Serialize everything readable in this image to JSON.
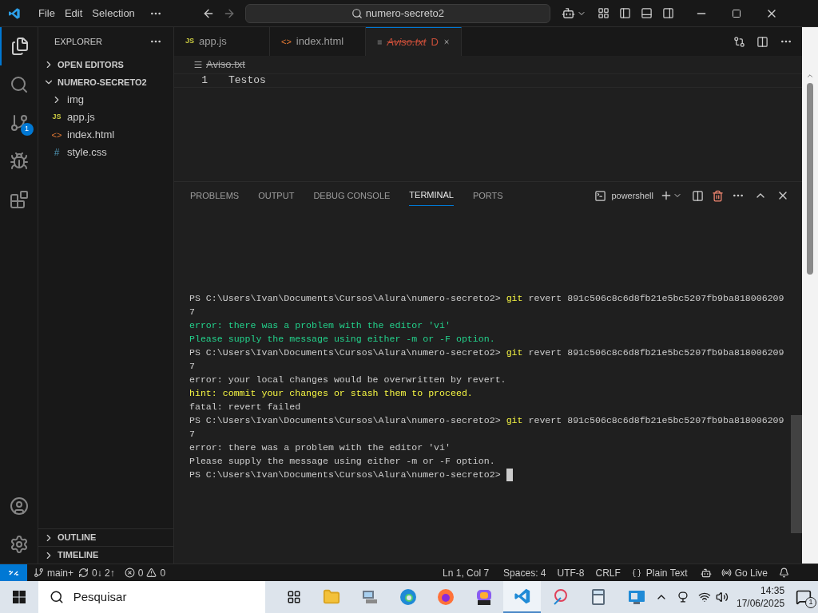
{
  "title_bar": {
    "menu": [
      "File",
      "Edit",
      "Selection"
    ],
    "search": "numero-secreto2"
  },
  "activity_bar": {
    "scm_badge": "1"
  },
  "sidebar": {
    "title": "EXPLORER",
    "sections": [
      {
        "label": "OPEN EDITORS",
        "expanded": false
      },
      {
        "label": "NUMERO-SECRETO2",
        "expanded": true,
        "children": [
          {
            "kind": "folder",
            "name": "img",
            "expanded": false
          },
          {
            "kind": "js",
            "name": "app.js",
            "icon": "JS"
          },
          {
            "kind": "html",
            "name": "index.html",
            "icon": "<>"
          },
          {
            "kind": "css",
            "name": "style.css",
            "icon": "#"
          }
        ]
      }
    ],
    "bottom_sections": [
      {
        "label": "OUTLINE",
        "expanded": false
      },
      {
        "label": "TIMELINE",
        "expanded": false
      }
    ]
  },
  "tabs": [
    {
      "kind": "js",
      "label": "app.js",
      "icon": "JS",
      "selected": false,
      "deleted": false
    },
    {
      "kind": "html",
      "label": "index.html",
      "icon": "<>",
      "selected": false,
      "deleted": false
    },
    {
      "kind": "txt",
      "label": "Aviso.txt",
      "selected": true,
      "deleted": true,
      "status": "D"
    }
  ],
  "breadcrumb": {
    "label": "Aviso.txt",
    "deleted": true
  },
  "editor": {
    "lines": [
      {
        "number": "1",
        "text": "Testos"
      }
    ]
  },
  "panel": {
    "tabs": [
      {
        "label": "PROBLEMS",
        "selected": false
      },
      {
        "label": "OUTPUT",
        "selected": false
      },
      {
        "label": "DEBUG CONSOLE",
        "selected": false
      },
      {
        "label": "TERMINAL",
        "selected": true
      },
      {
        "label": "PORTS",
        "selected": false
      }
    ],
    "shell": "powershell"
  },
  "terminal": {
    "lines": [
      {
        "kind": "prompt",
        "prompt": "PS C:\\Users\\Ivan\\Documents\\Cursos\\Alura\\numero-secreto2>",
        "command": "git",
        "args": "revert 891c506c8c6d8fb21e5bc5207fb9ba818006209"
      },
      {
        "kind": "output",
        "text": "7"
      },
      {
        "kind": "output",
        "text": "error: there was a problem with the editor 'vi'",
        "color": "#23d18b"
      },
      {
        "kind": "output",
        "text": "Please supply the message using either -m or -F option.",
        "color": "#23d18b"
      },
      {
        "kind": "prompt",
        "prompt": "PS C:\\Users\\Ivan\\Documents\\Cursos\\Alura\\numero-secreto2>",
        "command": "git",
        "args": "revert 891c506c8c6d8fb21e5bc5207fb9ba818006209"
      },
      {
        "kind": "output",
        "text": "7"
      },
      {
        "kind": "output",
        "text": "error: your local changes would be overwritten by revert."
      },
      {
        "kind": "output",
        "text": "hint: commit your changes or stash them to proceed.",
        "color": "#f5f543"
      },
      {
        "kind": "output",
        "text": "fatal: revert failed"
      },
      {
        "kind": "prompt",
        "prompt": "PS C:\\Users\\Ivan\\Documents\\Cursos\\Alura\\numero-secreto2>",
        "command": "git",
        "args": "revert 891c506c8c6d8fb21e5bc5207fb9ba818006209"
      },
      {
        "kind": "output",
        "text": "7"
      },
      {
        "kind": "output",
        "text": "error: there was a problem with the editor 'vi'"
      },
      {
        "kind": "output",
        "text": "Please supply the message using either -m or -F option."
      },
      {
        "kind": "prompt",
        "prompt": "PS C:\\Users\\Ivan\\Documents\\Cursos\\Alura\\numero-secreto2>",
        "cursor": true
      }
    ]
  },
  "status_bar": {
    "branch": "main+",
    "sync": "0↓ 2↑",
    "errors": "0",
    "warnings": "0",
    "position": "Ln 1, Col 7",
    "spaces": "Spaces: 4",
    "encoding": "UTF-8",
    "eol": "CRLF",
    "language": "Plain Text",
    "live": "Go Live"
  },
  "taskbar": {
    "search": "Pesquisar",
    "time": "14:35",
    "date": "17/06/2025",
    "notifications": "1"
  }
}
